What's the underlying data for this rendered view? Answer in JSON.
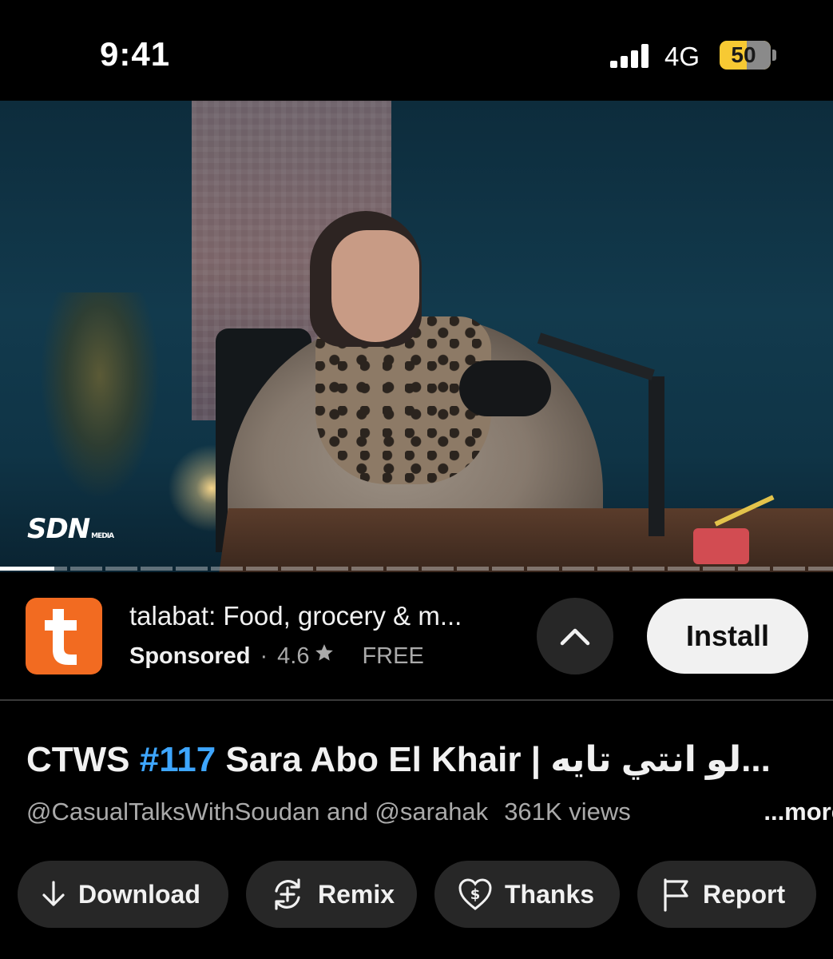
{
  "status_bar": {
    "time": "9:41",
    "network": "4G",
    "battery": "50"
  },
  "video": {
    "watermark": "SDN",
    "watermark_sub": "MEDIA",
    "progress": 0.065
  },
  "ad": {
    "title": "talabat: Food, grocery & m...",
    "sponsored_label": "Sponsored",
    "separator": "·",
    "rating": "4.6",
    "price": "FREE",
    "install_label": "Install",
    "icon_color": "#f26b21"
  },
  "video_info": {
    "title_prefix": "CTWS ",
    "title_hash": "#117",
    "title_rest": " Sara Abo El Khair | لو انتي تايه...",
    "channels": "@CasualTalksWithSoudan and @sarahak",
    "views": "361K views",
    "more_label": "...more"
  },
  "actions": [
    {
      "label": "Download",
      "icon": "download-icon"
    },
    {
      "label": "Remix",
      "icon": "remix-icon"
    },
    {
      "label": "Thanks",
      "icon": "thanks-icon"
    },
    {
      "label": "Report",
      "icon": "flag-icon"
    }
  ],
  "colors": {
    "background": "#000000",
    "chip": "#272727",
    "link_blue": "#3ea6ff",
    "battery_yellow": "#f7c933"
  }
}
